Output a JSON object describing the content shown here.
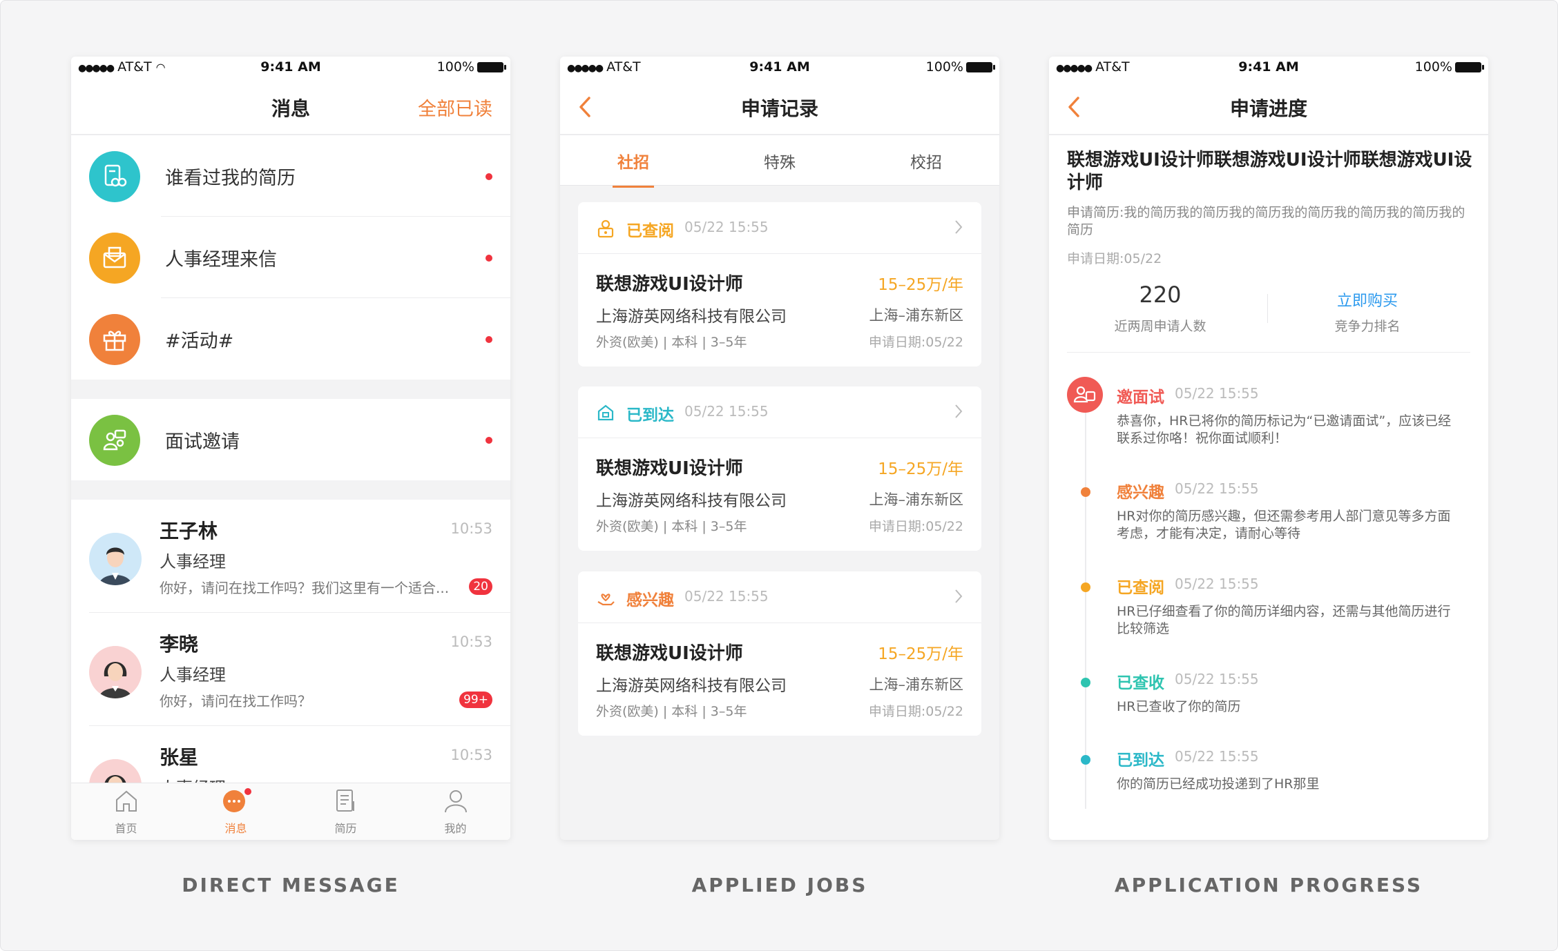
{
  "colors": {
    "accent": "#f0813b",
    "blue": "#2c9aee",
    "teal": "#2bb8c8",
    "yellow": "#f5a623",
    "red": "#f0333e",
    "green": "#7ac142"
  },
  "statusbar": {
    "carrier": "AT&T",
    "time": "9:41 AM",
    "battery": "100%"
  },
  "captions": [
    "DIRECT MESSAGE",
    "APPLIED JOBS",
    "APPLICATION PROGRESS"
  ],
  "messages": {
    "title": "消息",
    "mark_all_read": "全部已读",
    "system_items": [
      {
        "label": "谁看过我的简历",
        "icon": "resume-view-icon",
        "color": "#2ec4cc"
      },
      {
        "label": "人事经理来信",
        "icon": "envelope-icon",
        "color": "#f5a623"
      },
      {
        "label": "#活动#",
        "icon": "gift-icon",
        "color": "#f0813b"
      },
      {
        "label": "面试邀请",
        "icon": "interview-icon",
        "color": "#7ac142"
      }
    ],
    "chats": [
      {
        "name": "王子林",
        "role": "人事经理",
        "preview": "你好，请问在找工作吗？我们这里有一个适合...",
        "time": "10:53",
        "badge": "20"
      },
      {
        "name": "李晓",
        "role": "人事经理",
        "preview": "你好，请问在找工作吗？",
        "time": "10:53",
        "badge": "99+"
      },
      {
        "name": "张星",
        "role": "人事经理",
        "preview": "",
        "time": "10:53",
        "badge": ""
      }
    ],
    "tabs": [
      {
        "label": "首页",
        "icon": "home-icon"
      },
      {
        "label": "消息",
        "icon": "message-icon"
      },
      {
        "label": "简历",
        "icon": "resume-icon"
      },
      {
        "label": "我的",
        "icon": "profile-icon"
      }
    ]
  },
  "applied": {
    "title": "申请记录",
    "subtabs": [
      "社招",
      "特殊",
      "校招"
    ],
    "cards": [
      {
        "status": "已查阅",
        "status_color": "#f5a623",
        "icon": "viewed-icon",
        "date": "05/22 15:55",
        "job": "联想游戏UI设计师",
        "salary": "15–25万/年",
        "company": "上海游英网络科技有限公司",
        "location": "上海–浦东新区",
        "meta": "外资(欧美)  |  本科  |  3–5年",
        "apply_date": "申请日期:05/22"
      },
      {
        "status": "已到达",
        "status_color": "#2bb8c8",
        "icon": "delivered-icon",
        "date": "05/22 15:55",
        "job": "联想游戏UI设计师",
        "salary": "15–25万/年",
        "company": "上海游英网络科技有限公司",
        "location": "上海–浦东新区",
        "meta": "外资(欧美)  |  本科  |  3–5年",
        "apply_date": "申请日期:05/22"
      },
      {
        "status": "感兴趣",
        "status_color": "#f0813b",
        "icon": "interest-icon",
        "date": "05/22 15:55",
        "job": "联想游戏UI设计师",
        "salary": "15–25万/年",
        "company": "上海游英网络科技有限公司",
        "location": "上海–浦东新区",
        "meta": "外资(欧美)  |  本科  |  3–5年",
        "apply_date": "申请日期:05/22"
      }
    ]
  },
  "progress": {
    "title": "申请进度",
    "job_title": "联想游戏UI设计师联想游戏UI设计师联想游戏UI设计师",
    "resume_text": "申请简历:我的简历我的简历我的简历我的简历我的简历我的简历我的简历",
    "apply_date": "申请日期:05/22",
    "applicants_count": "220",
    "applicants_label": "近两周申请人数",
    "buy_label": "立即购买",
    "rank_label": "竞争力排名",
    "events": [
      {
        "label": "邀面试",
        "time": "05/22 15:55",
        "desc": "恭喜你，HR已将你的简历标记为“已邀请面试”，应该已经联系过你咯！祝你面试顺利！",
        "color": "#f05a55"
      },
      {
        "label": "感兴趣",
        "time": "05/22 15:55",
        "desc": "HR对你的简历感兴趣，但还需参考用人部门意见等多方面考虑，才能有决定，请耐心等待",
        "color": "#f0813b"
      },
      {
        "label": "已查阅",
        "time": "05/22 15:55",
        "desc": "HR已仔细查看了你的简历详细内容，还需与其他简历进行比较筛选",
        "color": "#f5a623"
      },
      {
        "label": "已查收",
        "time": "05/22 15:55",
        "desc": "HR已查收了你的简历",
        "color": "#2ec4b0"
      },
      {
        "label": "已到达",
        "time": "05/22 15:55",
        "desc": "你的简历已经成功投递到了HR那里",
        "color": "#2bb8c8"
      }
    ]
  }
}
